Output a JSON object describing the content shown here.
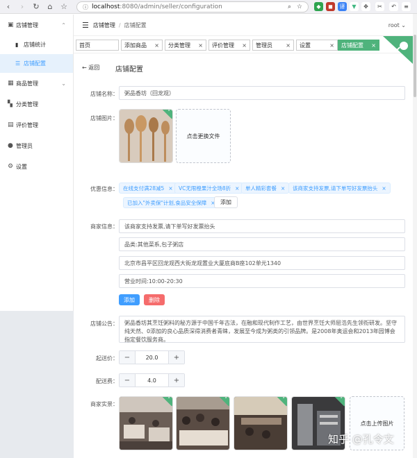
{
  "browser": {
    "url_host": "localhost",
    "url_path": ":8080/admin/seller/configuration"
  },
  "sidebar": {
    "store_mgmt": "店铺管理",
    "store_stats": "店铺统计",
    "store_config": "店铺配置",
    "product_mgmt": "商品管理",
    "category_mgmt": "分类管理",
    "review_mgmt": "评价管理",
    "admins": "管理员",
    "settings": "设置"
  },
  "header": {
    "crumb_parent": "店铺管理",
    "crumb_current": "店铺配置",
    "user": "root"
  },
  "tabs": [
    "首页",
    "添加商品",
    "分类管理",
    "评价管理",
    "管理员",
    "设置",
    "店铺配置"
  ],
  "page": {
    "back": "返回",
    "title": "店铺配置"
  },
  "form": {
    "name_label": "店铺名称：",
    "name_value": "粥品香坊（回龙观）",
    "image_label": "店铺图片：",
    "replace_file": "点击更换文件",
    "discount_label": "优惠信息：",
    "discounts": [
      "在线支付满28减5",
      "VC无限橙果汁全场8折",
      "单人精彩套餐",
      "该商家支持发票,请下单写好发票抬头",
      "已加入\"外卖保\"计划,食品安全保障"
    ],
    "add_tag": "添加",
    "merchant_label": "商家信息：",
    "merchant_info": [
      "该商家支持发票,请下单写好发票抬头",
      "品类:其他菜系,包子粥店",
      "北京市昌平区回龙观西大街龙观置业大厦底商B座102单元1340",
      "营业时间:10:00-20:30"
    ],
    "btn_add": "添加",
    "btn_delete": "删除",
    "notice_label": "店铺公告：",
    "notice_text": "粥品香坊其烹饪粥料的秘方源于中国千年古法，在融和现代制作工艺，由世界烹饪大师屈浩先生领衔研发。坚守纯天然、0添加的良心品质深得消费者青睐，发展至今成为粥类的引领品牌。是2008年奥运会和2013年园博会指定餐饮服务商。",
    "min_price_label": "起送价：",
    "min_price": "20.0",
    "delivery_fee_label": "配送费：",
    "delivery_fee": "4.0",
    "photos_label": "商家实景：",
    "upload_image": "点击上传图片"
  },
  "watermark": "知乎 @孔令文",
  "colors": {
    "accent": "#409eff",
    "success": "#4fb37c",
    "danger": "#f56c6c"
  }
}
